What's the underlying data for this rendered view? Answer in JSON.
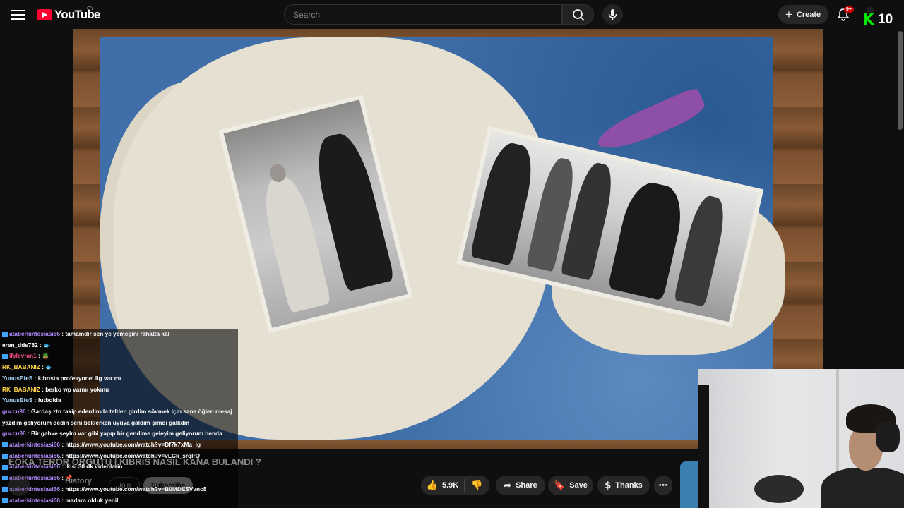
{
  "header": {
    "logo_text": "YouTube",
    "country_code": "CY",
    "search_placeholder": "Search",
    "create_label": "Create",
    "notifications_badge": "9+",
    "overlay_badge_letter": "K",
    "overlay_badge_number": "10"
  },
  "chat": {
    "messages": [
      {
        "user": "ataberkinteslasi66",
        "user_color": "#b38cff",
        "text": " : tamamdır sen ye yemeğini rahatta kal"
      },
      {
        "user": "eren_dds782",
        "user_color": "#ffffff",
        "text": " : 🐟"
      },
      {
        "user": "ifylevran1",
        "user_color": "#ff4d8d",
        "text": " : 🪴"
      },
      {
        "user": "RK_BABANIZ",
        "user_color": "#ffd54a",
        "text": " : 🐟"
      },
      {
        "user": "YunusEfeS",
        "user_color": "#a8d8ff",
        "text": " : kıbrısta profesyonel lig var mı"
      },
      {
        "user": "RK_BABANIZ",
        "user_color": "#ffd54a",
        "text": " : berko wp varmı yokmu"
      },
      {
        "user": "YunusEfeS",
        "user_color": "#a8d8ff",
        "text": " : futbolda"
      },
      {
        "user": "guccu96",
        "user_color": "#b38cff",
        "text": " : Gardaş ztn takip ederdimda telden girdim sövmek için sana öğlen mesaj"
      },
      {
        "user": "",
        "user_color": "#ffffff",
        "text": "yazdım geliyorum dedin seni beklerken uyuya galdım şimdi galkdm"
      },
      {
        "user": "guccu96",
        "user_color": "#b38cff",
        "text": " : Bir gahve şeylm var gibi yapıp bir gendime geleyim geliyorum benda"
      },
      {
        "user": "ataberkinteslasi66",
        "user_color": "#b38cff",
        "text": " : https://www.youtube.com/watch?v=Df7k7xMa_ig"
      },
      {
        "user": "ataberkinteslasi66",
        "user_color": "#b38cff",
        "text": " : https://www.youtube.com/watch?v=vLCk_srqIrQ"
      },
      {
        "user": "ataberkinteslasi66",
        "user_color": "#b38cff",
        "text": " : ikisi 30 dk videolarin"
      },
      {
        "user": "ataberkinteslasi66",
        "user_color": "#b38cff",
        "text": " : 📌"
      },
      {
        "user": "ataberkinteslasi66",
        "user_color": "#b38cff",
        "text": " : https://www.youtube.com/watch?v=B0MDESVvnc8"
      },
      {
        "user": "ataberkinteslasi66",
        "user_color": "#b38cff",
        "text": " : madara olduk yenil"
      }
    ]
  },
  "video": {
    "title": "EOKA TERÖR ÖRGÜTÜ | KIBRIS NASIL KANA BULANDI ?",
    "channel_name": "History",
    "join_label": "Join",
    "subscribe_label": "Subscribe",
    "like_count": "5.9K",
    "share_label": "Share",
    "save_label": "Save",
    "thanks_label": "Thanks"
  }
}
